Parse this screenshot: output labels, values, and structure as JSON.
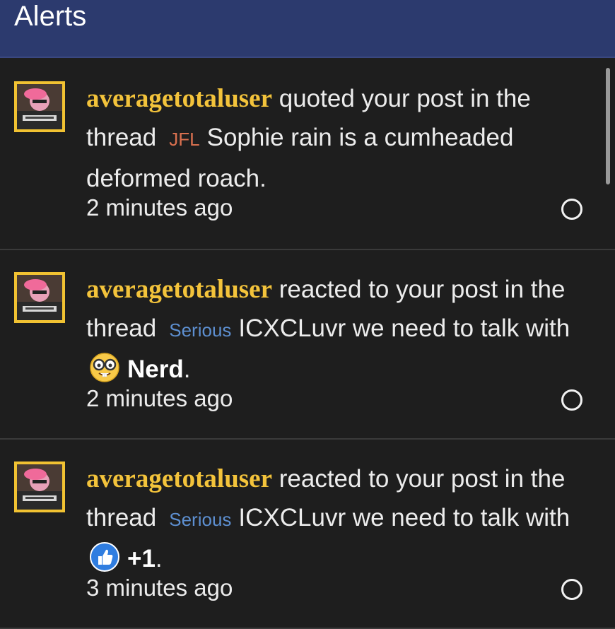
{
  "header": {
    "title": "Alerts"
  },
  "alerts": [
    {
      "username": "averagetotaluser",
      "action": " quoted your post in the thread",
      "prefix": "JFL",
      "thread_title": "Sophie rain is a cumheaded deformed roach.",
      "time": "2 minutes ago"
    },
    {
      "username": "averagetotaluser",
      "action": " reacted to your post in the thread",
      "prefix": "Serious",
      "thread_title": "ICXCLuvr we need to talk",
      "with_text": " with ",
      "reaction": "Nerd",
      "reaction_icon": "nerd-face-icon",
      "period": ".",
      "time": "2 minutes ago"
    },
    {
      "username": "averagetotaluser",
      "action": " reacted to your post in the thread",
      "prefix": "Serious",
      "thread_title": "ICXCLuvr we need to talk",
      "with_text": " with ",
      "reaction": "+1",
      "reaction_icon": "thumbs-up-icon",
      "period": ".",
      "time": "3 minutes ago"
    }
  ],
  "colors": {
    "header_bg": "#2c3a6e",
    "username": "#f3c33b",
    "prefix_jfl": "#d9704f",
    "prefix_serious": "#5d8fd0",
    "avatar_border": "#f1c232"
  }
}
